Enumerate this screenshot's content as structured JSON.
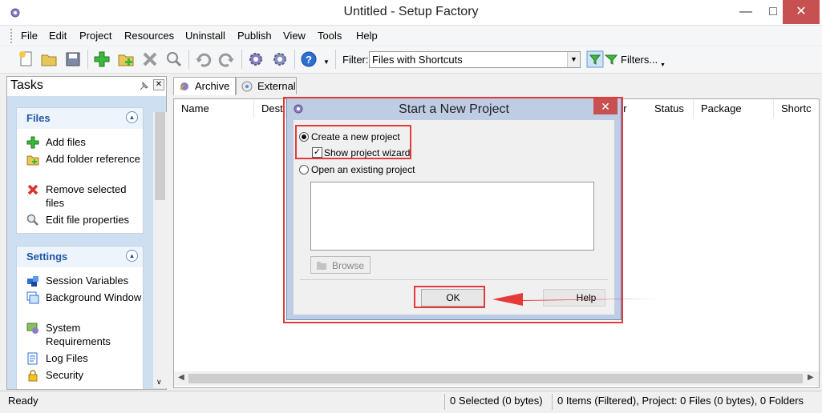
{
  "window": {
    "title": "Untitled - Setup Factory"
  },
  "menu": [
    "File",
    "Edit",
    "Project",
    "Resources",
    "Uninstall",
    "Publish",
    "View",
    "Tools",
    "Help"
  ],
  "toolbar": {
    "filter_label": "Filter:",
    "filter_value": "Files with Shortcuts",
    "filters_button": "Filters..."
  },
  "tasks": {
    "title": "Tasks",
    "files_group": {
      "title": "Files",
      "items": [
        "Add files",
        "Add folder reference",
        "Remove selected files",
        "Edit file properties"
      ]
    },
    "settings_group": {
      "title": "Settings",
      "items": [
        "Session Variables",
        "Background Window",
        "System Requirements",
        "Log Files",
        "Security"
      ]
    }
  },
  "tabs": [
    "Archive",
    "External"
  ],
  "columns": [
    "Name",
    "Dest",
    "er",
    "Status",
    "Package",
    "Shortc"
  ],
  "status": {
    "ready": "Ready",
    "selected": "0 Selected (0 bytes)",
    "items": "0 Items (Filtered), Project: 0 Files (0 bytes), 0 Folders"
  },
  "dialog": {
    "title": "Start a New Project",
    "option_new": "Create a new project",
    "option_wizard": "Show project wizard",
    "option_open": "Open an existing project",
    "browse": "Browse",
    "ok": "OK",
    "help": "Help"
  },
  "colors": {
    "highlight": "#e43a3a",
    "task_group_title": "#1f58a8",
    "task_background": "#cfdff2"
  }
}
